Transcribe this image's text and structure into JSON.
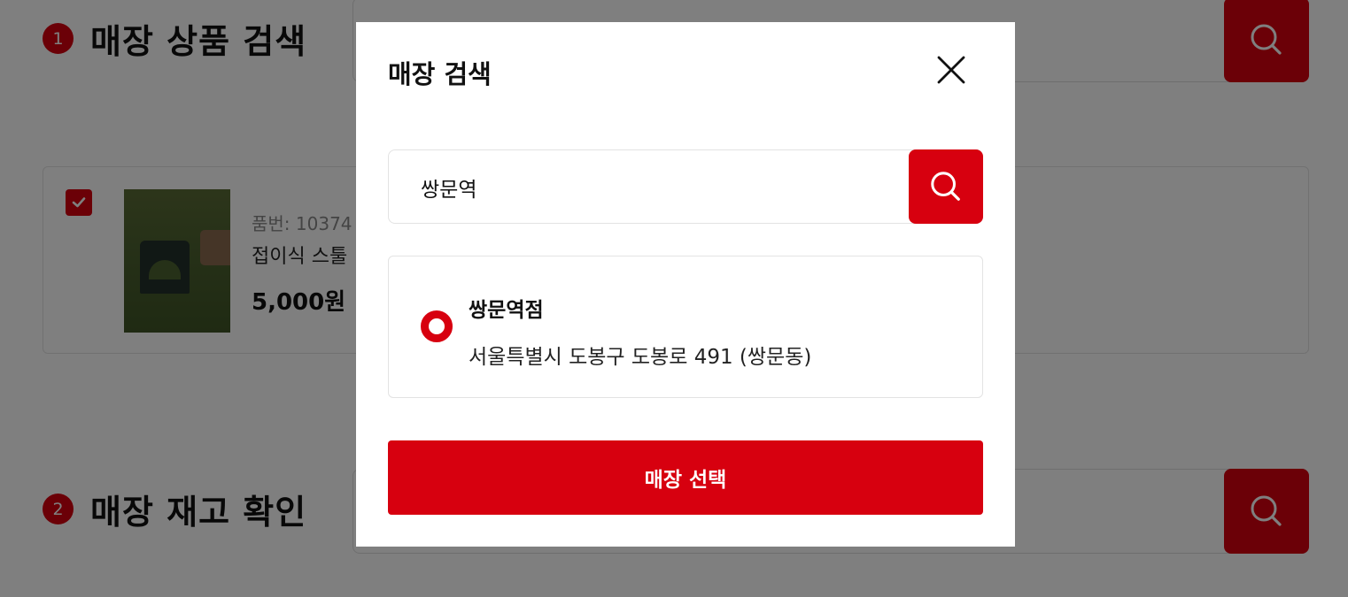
{
  "background": {
    "section1": {
      "step": "1",
      "title": "매장 상품 검색"
    },
    "section2": {
      "step": "2",
      "title": "매장 재고 확인"
    },
    "product": {
      "code": "품번: 10374",
      "name": "접이식 스툴",
      "price": "5,000원",
      "checked": true
    }
  },
  "modal": {
    "title": "매장 검색",
    "search": {
      "value": "쌍문역",
      "placeholder": ""
    },
    "results": [
      {
        "name": "쌍문역점",
        "address": "서울특별시 도봉구 도봉로 491 (쌍문동)",
        "selected": true
      }
    ],
    "select_button_label": "매장 선택"
  },
  "colors": {
    "accent": "#d7000f",
    "overlay": "rgba(0,0,0,0.5)"
  },
  "icons": [
    "search-icon",
    "close-icon",
    "checkmark-icon",
    "radio-selected-icon"
  ]
}
